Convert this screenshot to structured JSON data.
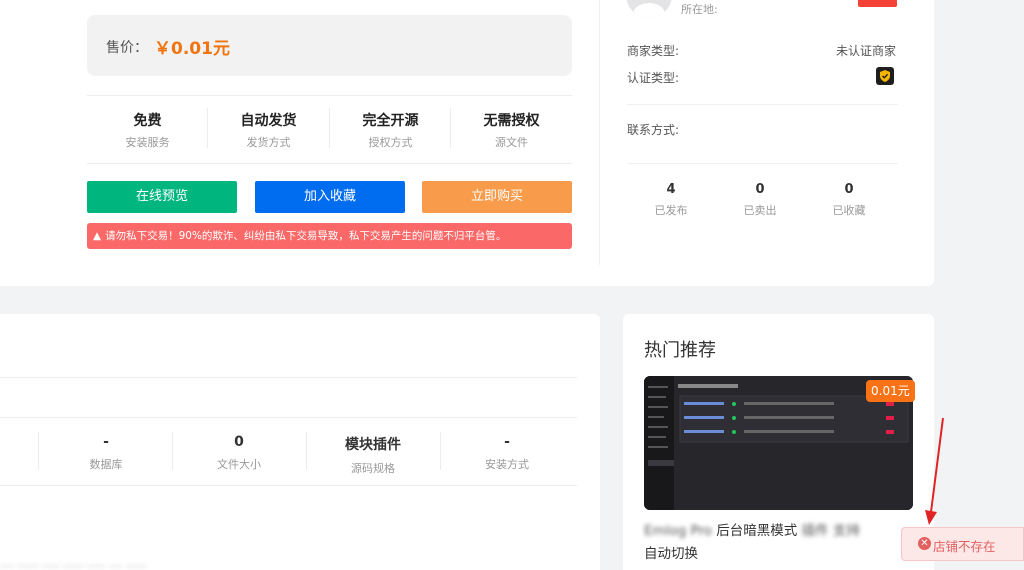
{
  "product": {
    "price_label": "售价：",
    "price_value": "￥0.01元",
    "features": [
      {
        "title": "免费",
        "sub": "安装服务"
      },
      {
        "title": "自动发货",
        "sub": "发货方式"
      },
      {
        "title": "完全开源",
        "sub": "授权方式"
      },
      {
        "title": "无需授权",
        "sub": "源文件"
      }
    ],
    "buttons": {
      "preview": "在线预览",
      "favorite": "加入收藏",
      "buy": "立即购买"
    },
    "warning": "请勿私下交易！90%的欺诈、纠纷由私下交易导致，私下交易产生的问题不归平台管。"
  },
  "seller": {
    "location_label": "所在地:",
    "merchant_type_label": "商家类型:",
    "merchant_type_value": "未认证商家",
    "verify_type_label": "认证类型:",
    "contact_label": "联系方式:",
    "stats": [
      {
        "value": "4",
        "label": "已发布"
      },
      {
        "value": "0",
        "label": "已卖出"
      },
      {
        "value": "0",
        "label": "已收藏"
      }
    ]
  },
  "specs": [
    {
      "value": "-",
      "label": "数据库"
    },
    {
      "value": "0",
      "label": "文件大小"
    },
    {
      "value": "模块插件",
      "label": "源码规格"
    },
    {
      "value": "-",
      "label": "安装方式"
    }
  ],
  "hot": {
    "title": "热门推荐",
    "item_price": "0.01元",
    "item_title_line1_visible": "后台暗黑模式",
    "item_title_line2": "自动切换"
  },
  "toast": {
    "message": "店铺不存在"
  },
  "colors": {
    "price": "#f0740f",
    "preview_btn": "#00b67f",
    "favorite_btn": "#006cf0",
    "buy_btn": "#f89c4c",
    "warning_bg": "#fb6868",
    "toast_text": "#e46060",
    "annotation_arrow": "#e02424"
  }
}
